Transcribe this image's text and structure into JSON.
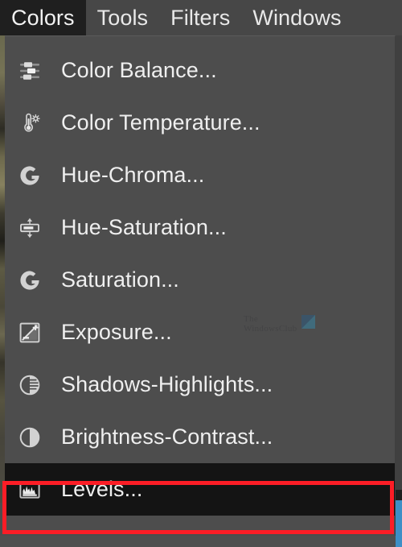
{
  "window": {
    "app_theme_bg": "#4d4d4d",
    "accent_highlight": "#fc1d26"
  },
  "menubar": {
    "items": [
      {
        "label": "Colors",
        "active": true
      },
      {
        "label": "Tools",
        "active": false
      },
      {
        "label": "Filters",
        "active": false
      },
      {
        "label": "Windows",
        "active": false
      }
    ]
  },
  "dropdown": {
    "owner": "Colors",
    "items": [
      {
        "label": "Color Balance...",
        "icon": "color-balance-sliders-icon",
        "selected": false
      },
      {
        "label": "Color Temperature...",
        "icon": "thermometer-sun-icon",
        "selected": false
      },
      {
        "label": "Hue-Chroma...",
        "icon": "gimp-g-circle-icon",
        "selected": false
      },
      {
        "label": "Hue-Saturation...",
        "icon": "hue-saturation-slider-icon",
        "selected": false
      },
      {
        "label": "Saturation...",
        "icon": "gimp-g-circle-icon",
        "selected": false
      },
      {
        "label": "Exposure...",
        "icon": "exposure-icon",
        "selected": false
      },
      {
        "label": "Shadows-Highlights...",
        "icon": "shadows-highlights-icon",
        "selected": false
      },
      {
        "label": "Brightness-Contrast...",
        "icon": "brightness-contrast-icon",
        "selected": false
      },
      {
        "label": "Levels...",
        "icon": "levels-histogram-icon",
        "selected": true
      }
    ]
  },
  "annotation": {
    "target_label": "Levels...",
    "color": "#fc1d26"
  },
  "watermark": {
    "line1": "The",
    "line2": "WindowsClub",
    "logo_color": "#24b0e8"
  }
}
